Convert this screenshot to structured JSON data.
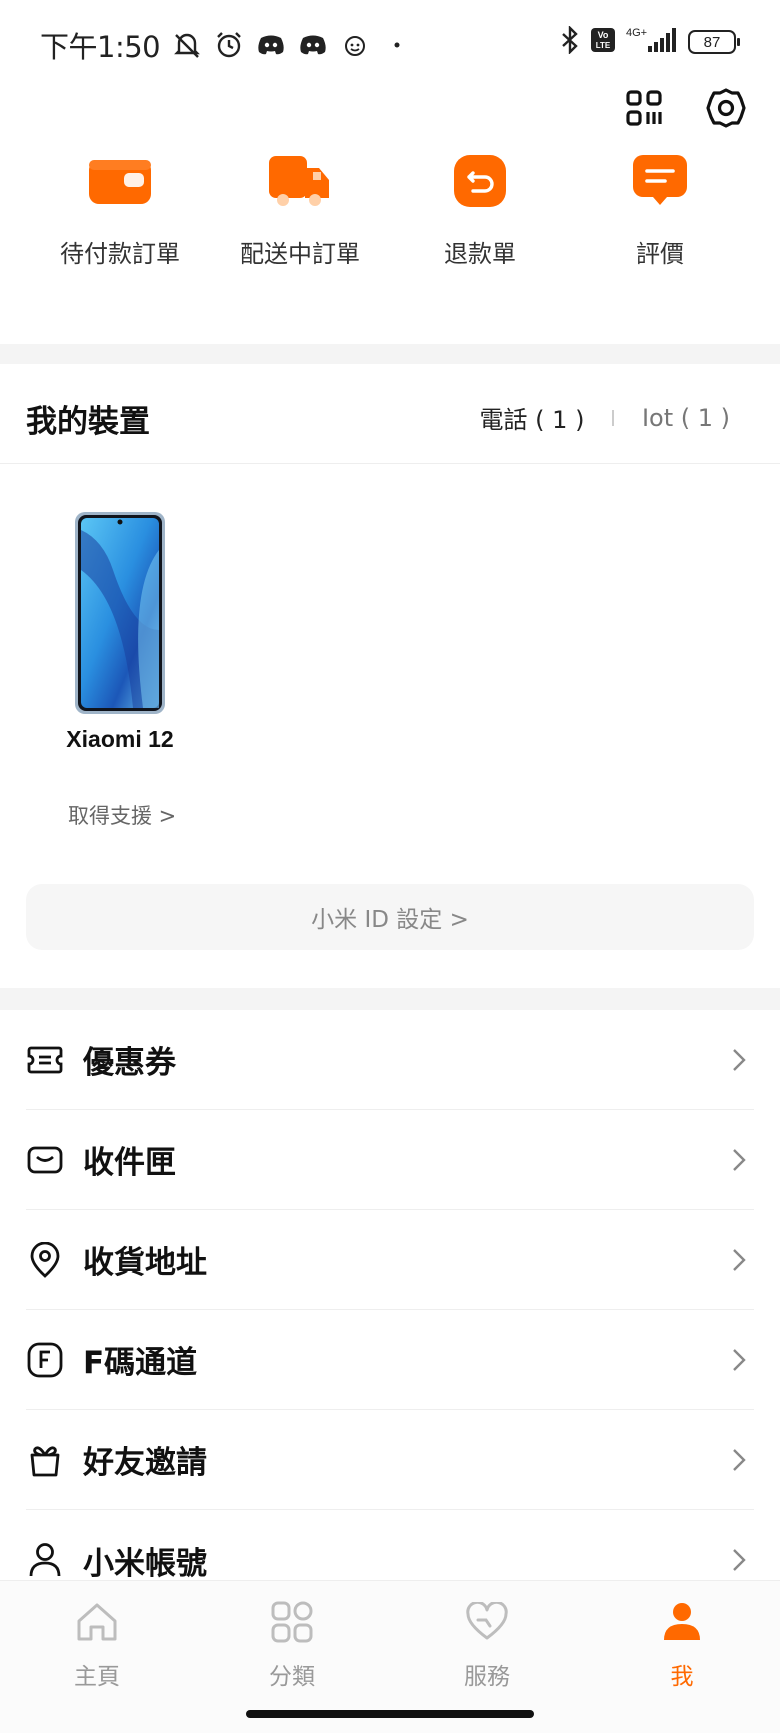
{
  "status_bar": {
    "time": "下午1:50",
    "battery": "87",
    "network": "4G+",
    "volte": "Vo LTE"
  },
  "top_actions": [
    {
      "icon": "qr-code-icon"
    },
    {
      "icon": "gear-icon"
    }
  ],
  "orders": [
    {
      "label": "待付款訂單",
      "icon": "wallet-icon"
    },
    {
      "label": "配送中訂單",
      "icon": "truck-icon"
    },
    {
      "label": "退款單",
      "icon": "refund-icon"
    },
    {
      "label": "評價",
      "icon": "review-icon"
    }
  ],
  "devices": {
    "title": "我的裝置",
    "tab_phone": "電話 ( 1 )",
    "tab_iot": "Iot ( 1 )",
    "device_name": "Xiaomi 12",
    "support_link": "取得支援 >"
  },
  "mi_id_button": "小米 ID 設定 >",
  "menu": [
    {
      "label": "優惠券",
      "icon": "coupon-icon"
    },
    {
      "label": "收件匣",
      "icon": "inbox-icon"
    },
    {
      "label": "收貨地址",
      "icon": "location-pin-icon"
    },
    {
      "label": "F碼通道",
      "icon": "f-code-icon"
    },
    {
      "label": "好友邀請",
      "icon": "gift-icon"
    },
    {
      "label": "小米帳號",
      "icon": "person-icon"
    }
  ],
  "tabs": [
    {
      "label": "主頁",
      "icon": "home-icon",
      "active": false
    },
    {
      "label": "分類",
      "icon": "category-icon",
      "active": false
    },
    {
      "label": "服務",
      "icon": "service-heart-icon",
      "active": false
    },
    {
      "label": "我",
      "icon": "me-icon",
      "active": true
    }
  ],
  "colors": {
    "accent": "#ff6900",
    "text": "#111111",
    "muted": "#999999",
    "divider": "#f4f4f4"
  }
}
